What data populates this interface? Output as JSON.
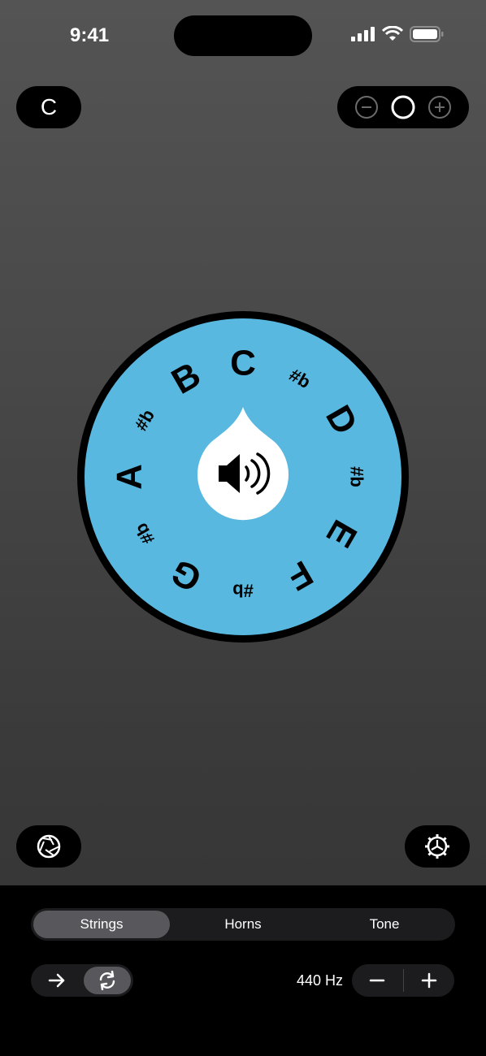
{
  "status_bar": {
    "time": "9:41"
  },
  "header": {
    "key_label": "C"
  },
  "wheel": {
    "notes": [
      "C",
      "D",
      "E",
      "F",
      "G",
      "A",
      "B"
    ],
    "accidentals": [
      "#b",
      "#b",
      "#b",
      "#b",
      "#b"
    ],
    "colors": {
      "face": "#59b8e0",
      "rim": "#000000",
      "center": "#ffffff"
    }
  },
  "controls": {
    "tabs": [
      {
        "label": "Strings",
        "active": true
      },
      {
        "label": "Horns",
        "active": false
      },
      {
        "label": "Tone",
        "active": false
      }
    ],
    "frequency": "440 Hz",
    "modes": [
      {
        "icon": "arrow-right-icon",
        "active": false
      },
      {
        "icon": "repeat-icon",
        "active": true
      }
    ]
  },
  "icons": [
    "minus-circle-icon",
    "circle-icon",
    "plus-circle-icon",
    "aperture-icon",
    "gear-icon",
    "speaker-icon",
    "signal-icon",
    "wifi-icon",
    "battery-icon"
  ]
}
